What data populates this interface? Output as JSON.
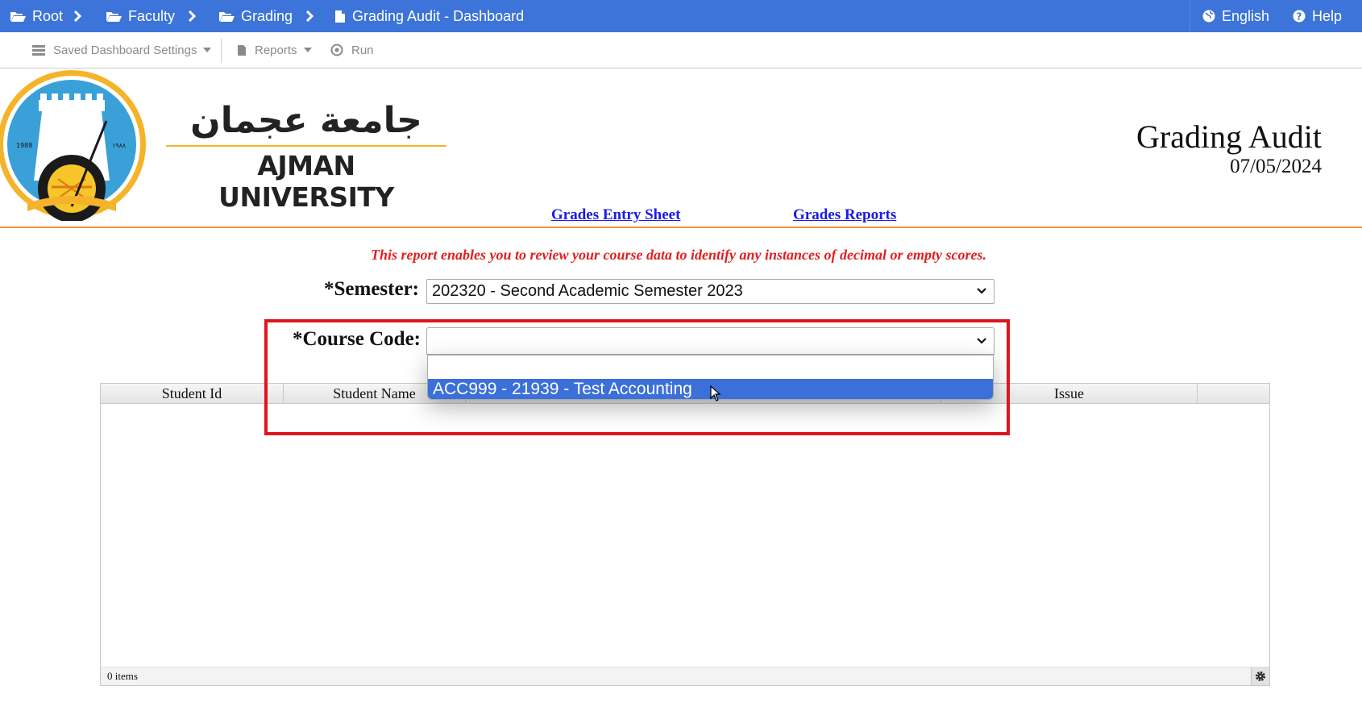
{
  "breadcrumb": [
    {
      "label": "Root",
      "icon": "folder-open-icon"
    },
    {
      "label": "Faculty",
      "icon": "folder-open-icon"
    },
    {
      "label": "Grading",
      "icon": "folder-open-icon"
    },
    {
      "label": "Grading Audit - Dashboard",
      "icon": "file-icon"
    }
  ],
  "topbar_right": {
    "language": "English",
    "help": "Help"
  },
  "toolbar": {
    "saved_settings": "Saved Dashboard Settings",
    "reports": "Reports",
    "run": "Run"
  },
  "header": {
    "arabic_name": "جامعة عجمان",
    "university_name": "AJMAN UNIVERSITY",
    "seal_year_left": "1988",
    "seal_year_right": "١٩٨٨",
    "title": "Grading Audit",
    "date": "07/05/2024"
  },
  "links": {
    "grades_entry": "Grades Entry Sheet",
    "grades_reports": "Grades Reports"
  },
  "notice": "This report enables you to review your course data to identify any instances of decimal or empty scores.",
  "form": {
    "semester_label": "*Semester:",
    "semester_value": "202320 - Second Academic Semester 2023",
    "course_label": "*Course Code:",
    "course_value": "",
    "course_options": [
      "",
      "ACC999 - 21939 - Test Accounting"
    ],
    "course_selected_option": "ACC999 - 21939 - Test Accounting"
  },
  "grid": {
    "columns": [
      "Student Id",
      "Student Name",
      "Issue"
    ],
    "rows": [],
    "items_count": "0 items"
  },
  "colors": {
    "topbar": "#3c74d9",
    "accent_orange": "#f0923a",
    "notice_red": "#e02020",
    "highlight_red": "#e0141e",
    "link_blue": "#1a1ae6",
    "option_selected": "#3b6fd9"
  }
}
